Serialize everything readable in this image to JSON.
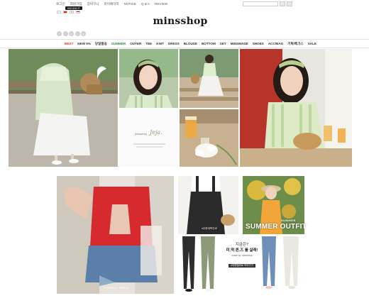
{
  "top_bar": {
    "links": [
      "로그인",
      "회원가입",
      "장바구니",
      "마이페이지",
      "NOTICE",
      "Q & A",
      "REVIEW"
    ],
    "cart_badge": "W2,000 P"
  },
  "brand": {
    "logo": "minsshop"
  },
  "nav": {
    "items": [
      "BEST",
      "NEW 5%",
      "당일발송",
      "SUMMER",
      "OUTER",
      "TEE",
      "KNIT",
      "DRESS",
      "BLOUSE",
      "BOTTOM",
      "SET",
      "MINSMADE",
      "SHOES",
      "ACC/BAG",
      "기획/특가스",
      "SALE"
    ],
    "active_color": "#d23a3a",
    "summer_color": "#2f8a4b"
  },
  "hero": {
    "signature_brand": "[minsshop]",
    "signature_script": "Jeja."
  },
  "tiles": {
    "coming_soon": "COMING SOON",
    "overall_tag": "#주문대박인싸",
    "summer_pre": "SUMMER",
    "summer_main": "SUMMER OUTFIT",
    "promo_line1": "지금은?",
    "promo_line2": "미.약.퀸.즈 를 살래!",
    "promo_made": "made by minsshop",
    "promo_btn": "#데뷔템바로 보러가기"
  }
}
